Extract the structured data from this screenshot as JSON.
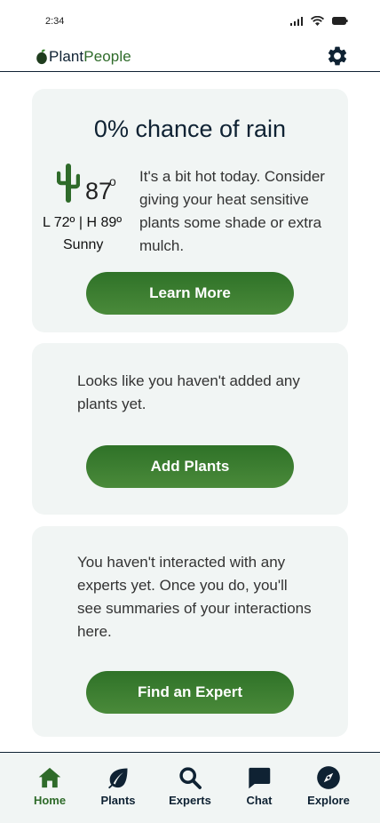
{
  "status": {
    "time": "2:34"
  },
  "header": {
    "logo_part1": "Plant",
    "logo_part2": "People"
  },
  "weather": {
    "rain_title": "0% chance of rain",
    "temp": "87",
    "temp_unit": "o",
    "hilo": "L 72º | H 89º",
    "condition": "Sunny",
    "tip": "It's a bit hot today. Consider giving your heat sensitive plants some shade or extra mulch.",
    "button_label": "Learn More"
  },
  "plants": {
    "message": "Looks like you haven't added any plants yet.",
    "button_label": "Add Plants"
  },
  "experts": {
    "message": "You haven't interacted with any experts yet. Once you do, you'll see summaries of your interactions here.",
    "button_label": "Find an Expert"
  },
  "nav": {
    "home": "Home",
    "plants": "Plants",
    "experts": "Experts",
    "chat": "Chat",
    "explore": "Explore",
    "active": "home"
  },
  "colors": {
    "primary": "#2f6b2a",
    "navy": "#0f2233",
    "card_bg": "#f1f5f4"
  },
  "icons": [
    "signal-icon",
    "wifi-icon",
    "battery-icon",
    "leaf-logo-icon",
    "gear-icon",
    "cactus-icon",
    "home-icon",
    "leaf-icon",
    "search-icon",
    "chat-icon",
    "compass-icon"
  ]
}
